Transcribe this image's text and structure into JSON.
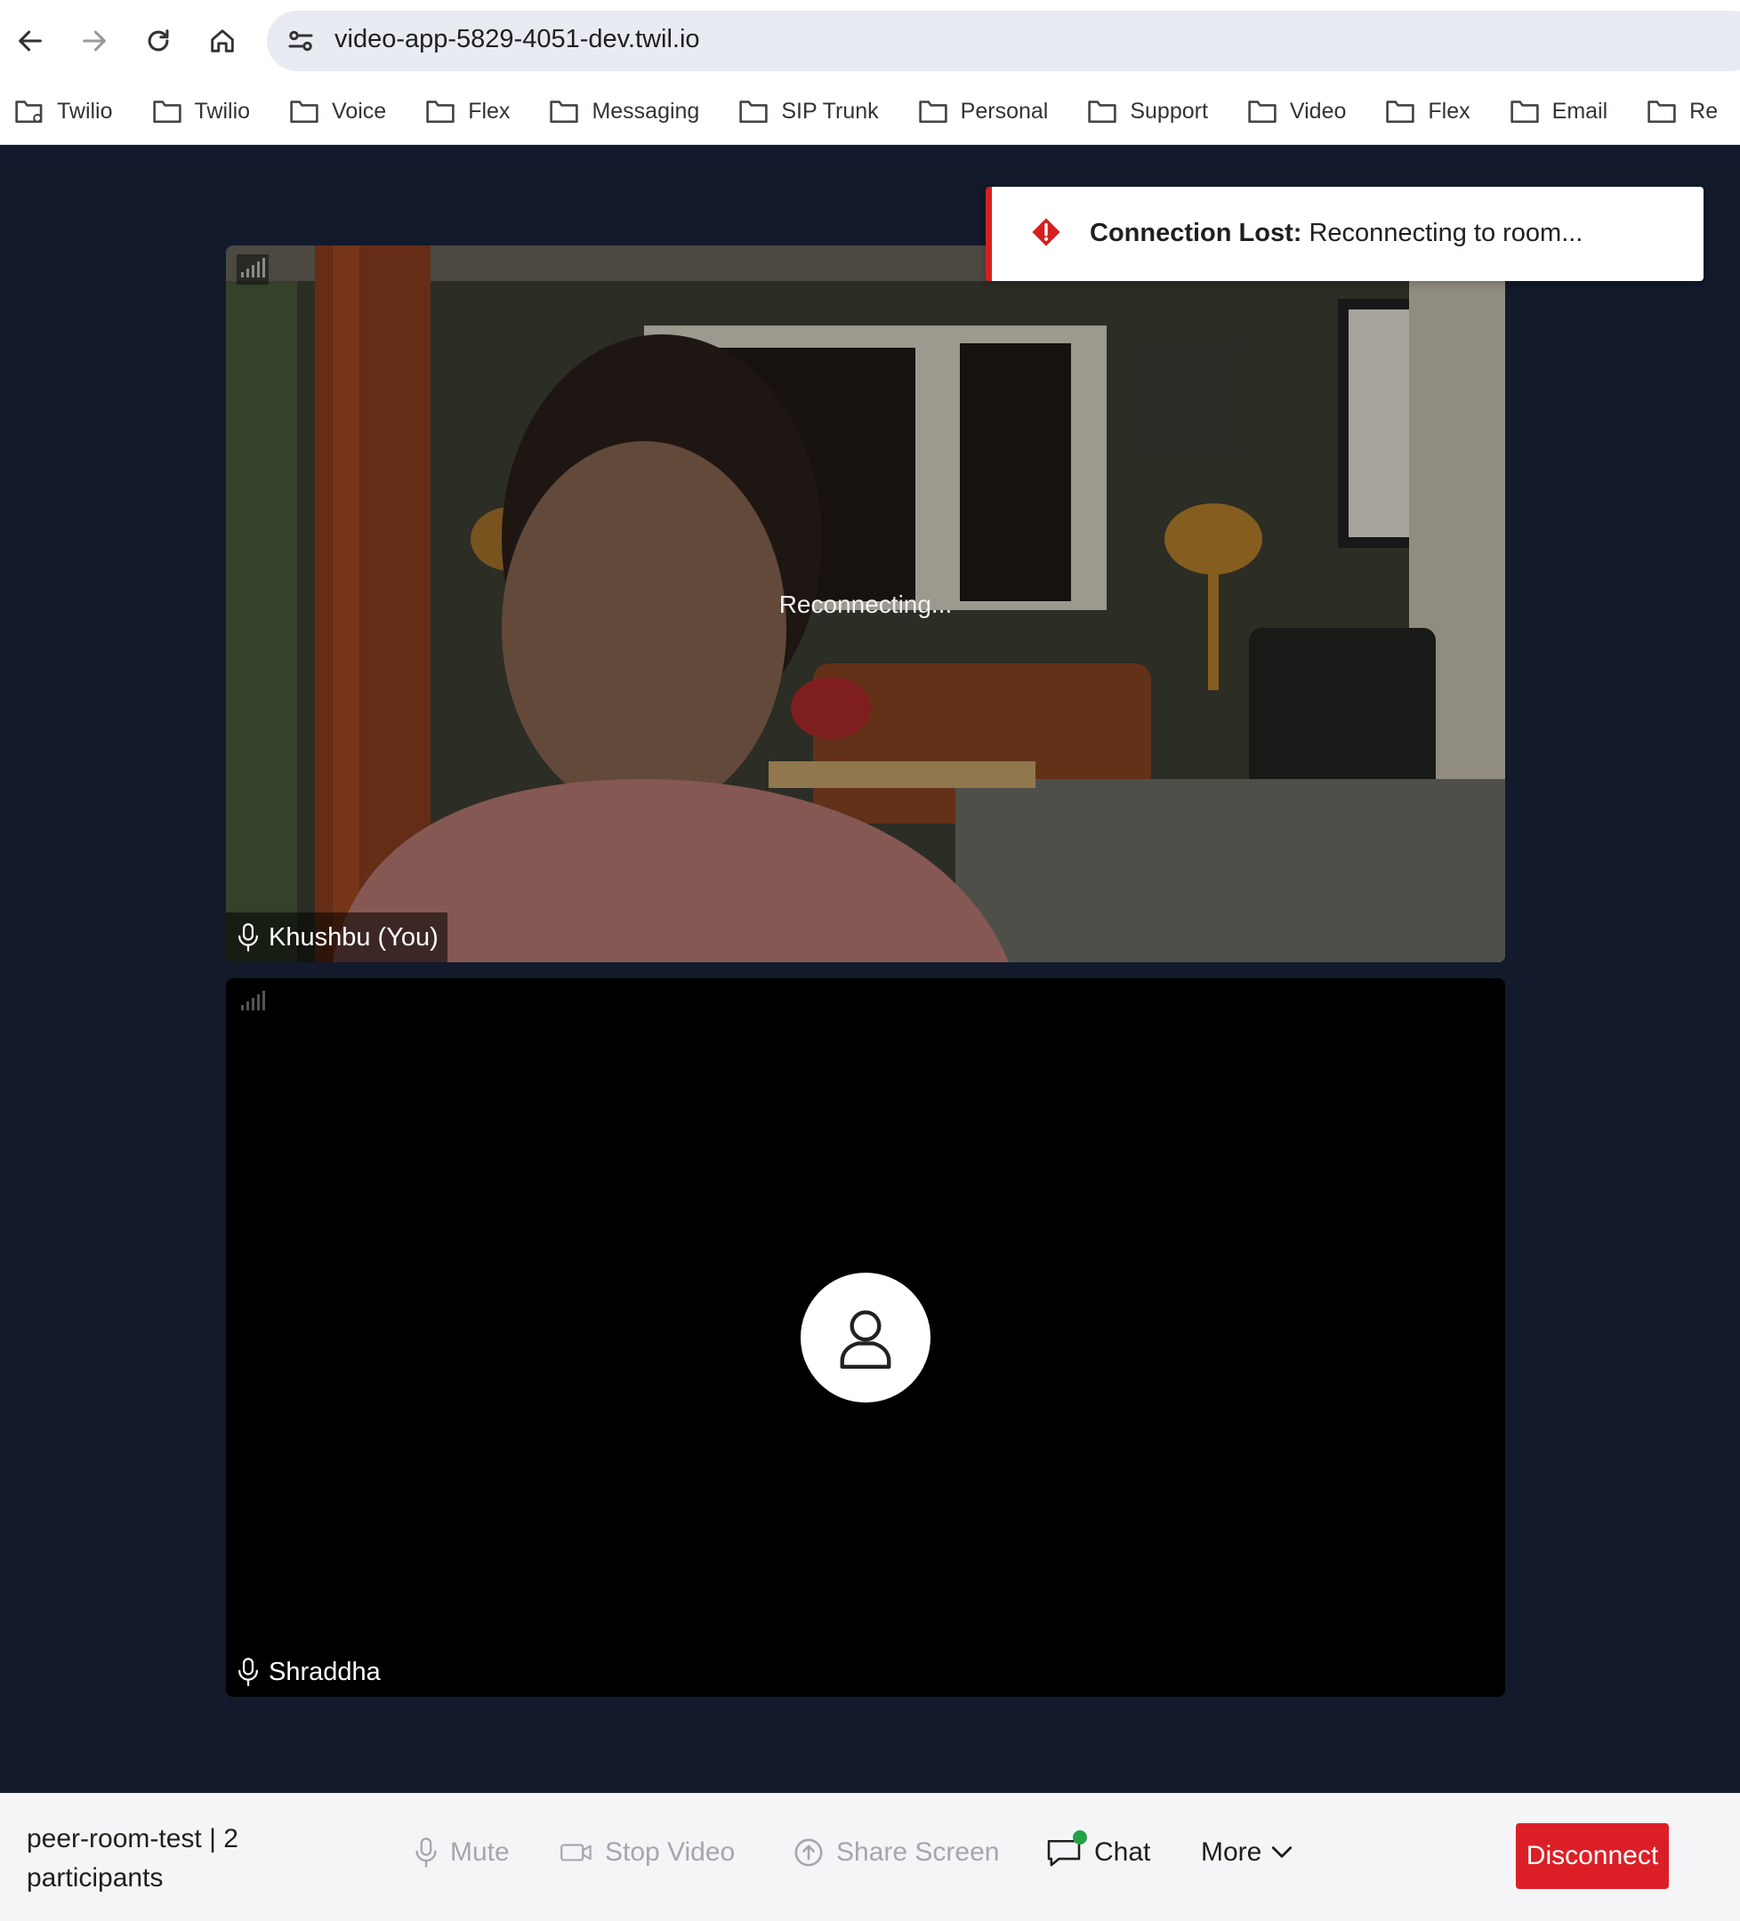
{
  "browser": {
    "url": "video-app-5829-4051-dev.twil.io",
    "bookmarks": [
      "Twilio",
      "Twilio",
      "Voice",
      "Flex",
      "Messaging",
      "SIP Trunk",
      "Personal",
      "Support",
      "Video",
      "Flex",
      "Email",
      "Re"
    ]
  },
  "toast": {
    "title": "Connection Lost:",
    "message": "Reconnecting to room..."
  },
  "participants": [
    {
      "name": "Khushbu (You)",
      "status": "Reconnecting..."
    },
    {
      "name": "Shraddha"
    }
  ],
  "controls": {
    "room_name": "peer-room-test | 2 participants",
    "mute": "Mute",
    "stop_video": "Stop Video",
    "share_screen": "Share Screen",
    "chat": "Chat",
    "more": "More",
    "disconnect": "Disconnect"
  },
  "colors": {
    "background": "#121a2b",
    "disconnect": "#dc1f26",
    "toast_accent": "#d61f1f",
    "chat_badge": "#24a148"
  }
}
